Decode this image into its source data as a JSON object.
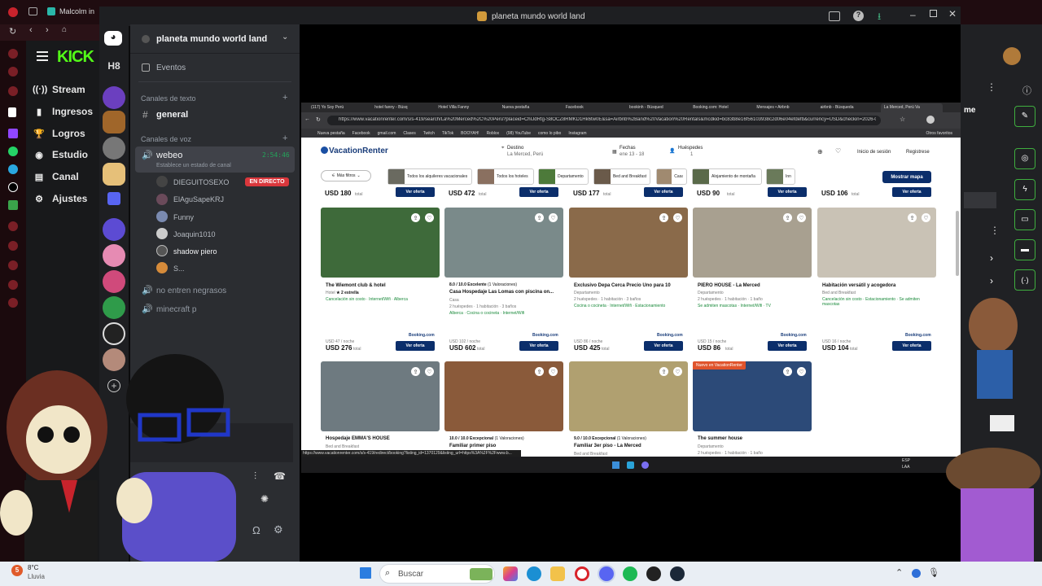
{
  "window_title": "planeta mundo world land",
  "top_left_tab": "Malcolm in",
  "kick": {
    "stream": "Stream",
    "ingresos": "Ingresos",
    "logros": "Logros",
    "estudio": "Estudio",
    "canal": "Canal",
    "ajustes": "Ajustes"
  },
  "rail_label": "H8",
  "discord": {
    "server_name": "planeta mundo world land",
    "eventos": "Eventos",
    "text_section": "Canales de texto",
    "text_channel": "general",
    "voice_section": "Canales de voz",
    "voice_channel": "webeo",
    "voice_timer": "2:54:46",
    "status_hint": "Establece un estado de canal",
    "live_badge": "EN DIRECTO",
    "members": [
      "DIEGUITOSEXO",
      "ElAguSapeKRJ",
      "Funny",
      "Joaquin1010",
      "shadow piero",
      "S..."
    ],
    "voice_channel2": "no entren negrasos",
    "voice_channel3": "minecraft p"
  },
  "browser": {
    "tabs": [
      "(117) Yo Soy Perú",
      "hotel fanny - Búsq",
      "Hotel Villa Fanny",
      "Nueva pestaña",
      "Facebook",
      "bookinh - Búsqued",
      "Booking.com: Hotel",
      "Mensajes • Airbnb",
      "airbnb - Búsqueda",
      "La Merced, Perú Va"
    ],
    "url": "https://www.vacationrenter.com/s/s-419/search/La%20Merced%2C%20Perú?placeid=ChIJdRtg-S8OCZ8RMKD1Hk6tw0E&sa=Airbnb%2Band%20Vacation%20Rentals&mcdkid=bc83b8e16f56103938c2d06e04efdefb&currency=USD&checkin=2026-0...",
    "bookmarks": [
      "Nueva pestaña",
      "Facebook",
      "gmail.com",
      "Clases",
      "Twitch",
      "TikTok",
      "BOOYAH!",
      "Roblox",
      "(98) YouTube",
      "como lo pibo",
      "Instagram",
      "Otros favoritos"
    ]
  },
  "site": {
    "logo": "VacationRenter",
    "destino_label": "Destino",
    "destino_value": "La Merced, Perú",
    "fechas_label": "Fechas",
    "fechas_value": "ene 13 - 18",
    "huespedes_label": "Huéspedes",
    "huespedes_value": "1",
    "login": "Inicio de sesión",
    "register": "Registrese",
    "more_filters": "Más filtros",
    "filters": [
      "Todos los alquileres vacacionales",
      "Todos los hoteles",
      "Departamento",
      "Bed and Breakfast",
      "Casa",
      "Alojamiento de montaña",
      "Inn"
    ],
    "map_button": "Mostrar mapa",
    "top_prices": [
      "USD 180",
      "USD 472",
      "USD 177",
      "USD 90",
      "USD 106"
    ],
    "total": "total",
    "deal": "Ver oferta",
    "cards": [
      {
        "title": "The Wiemont club & hotel",
        "type": "Hotel",
        "stars": "2 estrella",
        "amen": "Cancelación sin costo · Internet/Wifi · Alberca",
        "pernight": "USD 47 / noche",
        "price": "USD 276",
        "source": "Booking.com"
      },
      {
        "score": "8.0 / 10.0",
        "score_label": "Excelente",
        "reviews": "(1 Valoraciones)",
        "title": "Casa Hospedaje Las Lomas con piscina on...",
        "type": "Casa",
        "info": "2 huéspedes · 1 habitación · 3 baños",
        "amen": "Alberca · Cocina o cocineta · Internet/Wifi",
        "pernight": "USD 102 / noche",
        "price": "USD 602",
        "source": "Booking.com"
      },
      {
        "title": "Exclusivo Depa Cerca Precio Uno para 10",
        "type": "Departamento",
        "info": "2 huéspedes · 1 habitación · 3 baños",
        "amen": "Cocina o cocineta · Internet/Wifi · Estacionamiento",
        "pernight": "USD 86 / noche",
        "price": "USD 425",
        "source": "Booking.com"
      },
      {
        "title": "PIERO HOUSE - La Merced",
        "type": "Departamento",
        "info": "2 huéspedes · 1 habitación · 1 baño",
        "amen": "Se admiten mascotas · Internet/Wifi · TV",
        "pernight": "USD 15 / noche",
        "price": "USD 86",
        "source": "Booking.com"
      },
      {
        "title": "Habitación versátil y acogedora",
        "type": "Bed and Breakfast",
        "amen": "Cancelación sin costo · Estacionamiento · Se admiten mascotas",
        "pernight": "USD 16 / noche",
        "price": "USD 104",
        "source": "Booking.com"
      },
      {
        "title": "Hospedaje EMMA'S HOUSE",
        "type": "Bed and Breakfast"
      },
      {
        "score": "10.0 / 10.0",
        "score_label": "Excepcional",
        "reviews": "(1 Valoraciones)",
        "title": "Familiar primer piso"
      },
      {
        "score": "9.0 / 10.0",
        "score_label": "Excepcional",
        "reviews": "(1 Valoraciones)",
        "title": "Familiar 3er piso - La Merced",
        "type": "Bed and Breakfast"
      },
      {
        "badge": "Nuevo en VacationRenter",
        "title": "The summer house",
        "type": "Departamento",
        "info": "2 huéspedes · 1 habitación · 1 baño"
      }
    ],
    "status_url": "https://www.vacationrenter.com/s/s-419/redirect/booking?listing_id=1370129&listing_url=https%3A%2F%2Fwww.b..."
  },
  "inner_taskbar": {
    "lang": "ESP",
    "lang2": "LAA"
  },
  "taskbar": {
    "weather_temp": "8°C",
    "weather_desc": "Lluvia",
    "search": "Buscar",
    "weather_badge": "5"
  },
  "right_panel": {
    "label": "me"
  }
}
